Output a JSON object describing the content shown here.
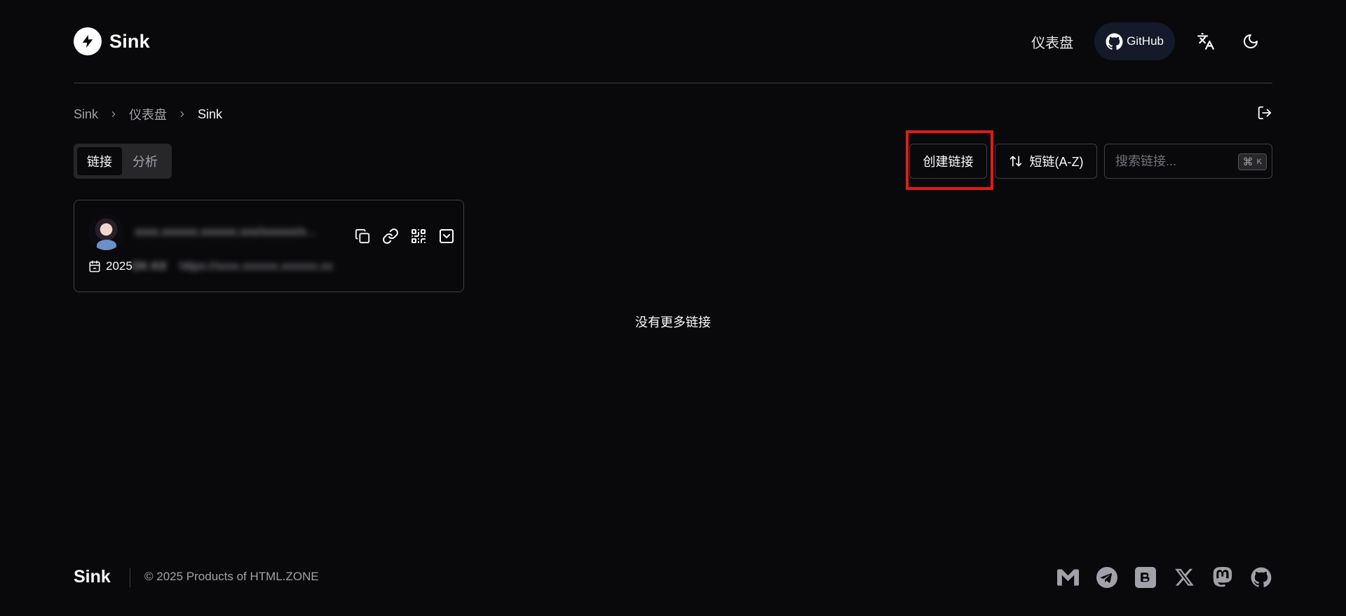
{
  "header": {
    "logo_text": "Sink",
    "nav": {
      "dashboard_label": "仪表盘",
      "github_label": "GitHub"
    },
    "icons": [
      "bolt-icon",
      "github-icon",
      "translate-icon",
      "moon-icon"
    ]
  },
  "breadcrumb": [
    "Sink",
    "仪表盘",
    "Sink"
  ],
  "tabs": [
    {
      "label": "链接",
      "active": true
    },
    {
      "label": "分析",
      "active": false
    }
  ],
  "toolbar": {
    "create_label": "创建链接",
    "sort_label": "短链(A-Z)",
    "search_placeholder": "搜索链接...",
    "shortcut_cmd": "⌘",
    "shortcut_key": "K"
  },
  "links": [
    {
      "slug": "xxxx.xxxxxx.xxxxxx.xxx/xxxxxx/x...",
      "date_visible": "2025",
      "date_hidden": "0X-XX",
      "url": "https://xxxx.xxxxxx.xxxxxx.xxx"
    }
  ],
  "list_end_text": "没有更多链接",
  "footer": {
    "brand": "Sink",
    "copyright": "© 2025 Products of HTML.ZONE",
    "socials": [
      "email-icon",
      "telegram-icon",
      "blog-icon",
      "x-icon",
      "mastodon-icon",
      "github-icon"
    ]
  },
  "colors": {
    "background": "#09090b",
    "border": "#3f3f46",
    "github_pill": "#141a29",
    "highlight": "#e01b1b",
    "muted_text": "#a1a1aa"
  }
}
